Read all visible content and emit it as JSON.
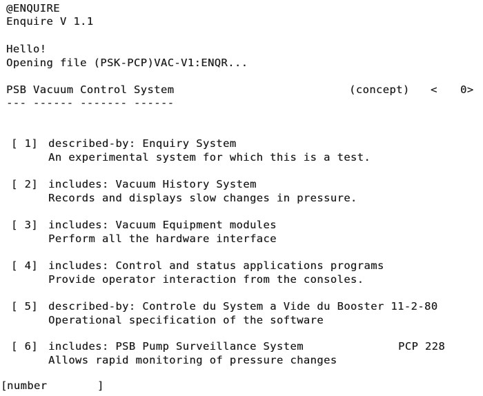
{
  "session": {
    "command": "@ENQUIRE",
    "version": "Enquire V 1.1",
    "greeting": "Hello!",
    "opening_message": "Opening file (PSK-PCP)VAC-V1:ENQR..."
  },
  "node": {
    "title": "PSB Vacuum Control System",
    "underline": "--- ------ ------- ------",
    "type": "(concept)",
    "nav_prev": "<",
    "nav_next": "0>"
  },
  "links": [
    {
      "number": "[ 1]",
      "relation": "described-by: Enquiry System",
      "description": "An experimental system for which this is a test.",
      "extra": ""
    },
    {
      "number": "[ 2]",
      "relation": "includes: Vacuum History System",
      "description": "Records and displays slow changes in pressure.",
      "extra": ""
    },
    {
      "number": "[ 3]",
      "relation": "includes: Vacuum Equipment modules",
      "description": "Perform all the hardware interface",
      "extra": ""
    },
    {
      "number": "[ 4]",
      "relation": "includes: Control and status applications programs",
      "description": "Provide operator interaction from the consoles.",
      "extra": ""
    },
    {
      "number": "[ 5]",
      "relation": "described-by: Controle du System a Vide du Booster 11-2-80",
      "description": "Operational specification of the software",
      "extra": ""
    },
    {
      "number": "[ 6]",
      "relation": "includes: PSB Pump Surveillance System",
      "description": "Allows rapid monitoring of pressure changes",
      "extra": "PCP 228"
    }
  ],
  "prompt": {
    "open_bracket": "[",
    "label": "number",
    "close_bracket": "]"
  }
}
